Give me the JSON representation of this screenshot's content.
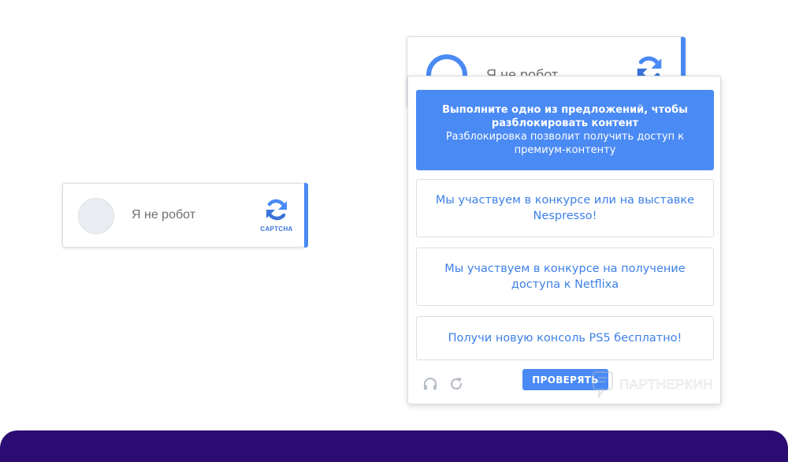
{
  "captcha": {
    "label": "Я не робот",
    "logo_text": "CAPTCHA"
  },
  "captcha_behind": {
    "label": "Я не робот"
  },
  "popup": {
    "header_title": "Выполните одно из предложений, чтобы разблокировать контент",
    "header_subtitle": "Разблокировка позволит получить доступ к премиум-контенту",
    "offers": [
      "Мы участвуем в конкурсе или на выставке Nespresso!",
      "Мы участвуем в конкурсе на получение доступа к Netflixa",
      "Получи новую консоль PS5 бесплатно!"
    ],
    "verify_label": "ПРОВЕРЯТЬ",
    "footer_icons": [
      "headphones-icon",
      "reload-icon"
    ]
  },
  "watermark": {
    "text": "ПАРТНЕРКИН"
  },
  "colors": {
    "accent": "#4a8af4",
    "offer_text": "#3d80e6",
    "banner": "#2b0c72"
  }
}
